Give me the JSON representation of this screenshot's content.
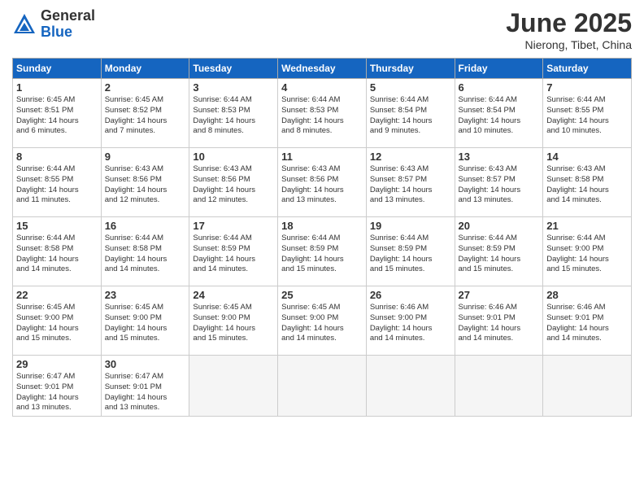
{
  "header": {
    "logo_general": "General",
    "logo_blue": "Blue",
    "title": "June 2025",
    "location": "Nierong, Tibet, China"
  },
  "weekdays": [
    "Sunday",
    "Monday",
    "Tuesday",
    "Wednesday",
    "Thursday",
    "Friday",
    "Saturday"
  ],
  "weeks": [
    [
      {
        "day": "1",
        "info": "Sunrise: 6:45 AM\nSunset: 8:51 PM\nDaylight: 14 hours\nand 6 minutes."
      },
      {
        "day": "2",
        "info": "Sunrise: 6:45 AM\nSunset: 8:52 PM\nDaylight: 14 hours\nand 7 minutes."
      },
      {
        "day": "3",
        "info": "Sunrise: 6:44 AM\nSunset: 8:53 PM\nDaylight: 14 hours\nand 8 minutes."
      },
      {
        "day": "4",
        "info": "Sunrise: 6:44 AM\nSunset: 8:53 PM\nDaylight: 14 hours\nand 8 minutes."
      },
      {
        "day": "5",
        "info": "Sunrise: 6:44 AM\nSunset: 8:54 PM\nDaylight: 14 hours\nand 9 minutes."
      },
      {
        "day": "6",
        "info": "Sunrise: 6:44 AM\nSunset: 8:54 PM\nDaylight: 14 hours\nand 10 minutes."
      },
      {
        "day": "7",
        "info": "Sunrise: 6:44 AM\nSunset: 8:55 PM\nDaylight: 14 hours\nand 10 minutes."
      }
    ],
    [
      {
        "day": "8",
        "info": "Sunrise: 6:44 AM\nSunset: 8:55 PM\nDaylight: 14 hours\nand 11 minutes."
      },
      {
        "day": "9",
        "info": "Sunrise: 6:43 AM\nSunset: 8:56 PM\nDaylight: 14 hours\nand 12 minutes."
      },
      {
        "day": "10",
        "info": "Sunrise: 6:43 AM\nSunset: 8:56 PM\nDaylight: 14 hours\nand 12 minutes."
      },
      {
        "day": "11",
        "info": "Sunrise: 6:43 AM\nSunset: 8:56 PM\nDaylight: 14 hours\nand 13 minutes."
      },
      {
        "day": "12",
        "info": "Sunrise: 6:43 AM\nSunset: 8:57 PM\nDaylight: 14 hours\nand 13 minutes."
      },
      {
        "day": "13",
        "info": "Sunrise: 6:43 AM\nSunset: 8:57 PM\nDaylight: 14 hours\nand 13 minutes."
      },
      {
        "day": "14",
        "info": "Sunrise: 6:43 AM\nSunset: 8:58 PM\nDaylight: 14 hours\nand 14 minutes."
      }
    ],
    [
      {
        "day": "15",
        "info": "Sunrise: 6:44 AM\nSunset: 8:58 PM\nDaylight: 14 hours\nand 14 minutes."
      },
      {
        "day": "16",
        "info": "Sunrise: 6:44 AM\nSunset: 8:58 PM\nDaylight: 14 hours\nand 14 minutes."
      },
      {
        "day": "17",
        "info": "Sunrise: 6:44 AM\nSunset: 8:59 PM\nDaylight: 14 hours\nand 14 minutes."
      },
      {
        "day": "18",
        "info": "Sunrise: 6:44 AM\nSunset: 8:59 PM\nDaylight: 14 hours\nand 15 minutes."
      },
      {
        "day": "19",
        "info": "Sunrise: 6:44 AM\nSunset: 8:59 PM\nDaylight: 14 hours\nand 15 minutes."
      },
      {
        "day": "20",
        "info": "Sunrise: 6:44 AM\nSunset: 8:59 PM\nDaylight: 14 hours\nand 15 minutes."
      },
      {
        "day": "21",
        "info": "Sunrise: 6:44 AM\nSunset: 9:00 PM\nDaylight: 14 hours\nand 15 minutes."
      }
    ],
    [
      {
        "day": "22",
        "info": "Sunrise: 6:45 AM\nSunset: 9:00 PM\nDaylight: 14 hours\nand 15 minutes."
      },
      {
        "day": "23",
        "info": "Sunrise: 6:45 AM\nSunset: 9:00 PM\nDaylight: 14 hours\nand 15 minutes."
      },
      {
        "day": "24",
        "info": "Sunrise: 6:45 AM\nSunset: 9:00 PM\nDaylight: 14 hours\nand 15 minutes."
      },
      {
        "day": "25",
        "info": "Sunrise: 6:45 AM\nSunset: 9:00 PM\nDaylight: 14 hours\nand 14 minutes."
      },
      {
        "day": "26",
        "info": "Sunrise: 6:46 AM\nSunset: 9:00 PM\nDaylight: 14 hours\nand 14 minutes."
      },
      {
        "day": "27",
        "info": "Sunrise: 6:46 AM\nSunset: 9:01 PM\nDaylight: 14 hours\nand 14 minutes."
      },
      {
        "day": "28",
        "info": "Sunrise: 6:46 AM\nSunset: 9:01 PM\nDaylight: 14 hours\nand 14 minutes."
      }
    ],
    [
      {
        "day": "29",
        "info": "Sunrise: 6:47 AM\nSunset: 9:01 PM\nDaylight: 14 hours\nand 13 minutes."
      },
      {
        "day": "30",
        "info": "Sunrise: 6:47 AM\nSunset: 9:01 PM\nDaylight: 14 hours\nand 13 minutes."
      },
      {
        "day": "",
        "info": ""
      },
      {
        "day": "",
        "info": ""
      },
      {
        "day": "",
        "info": ""
      },
      {
        "day": "",
        "info": ""
      },
      {
        "day": "",
        "info": ""
      }
    ]
  ]
}
